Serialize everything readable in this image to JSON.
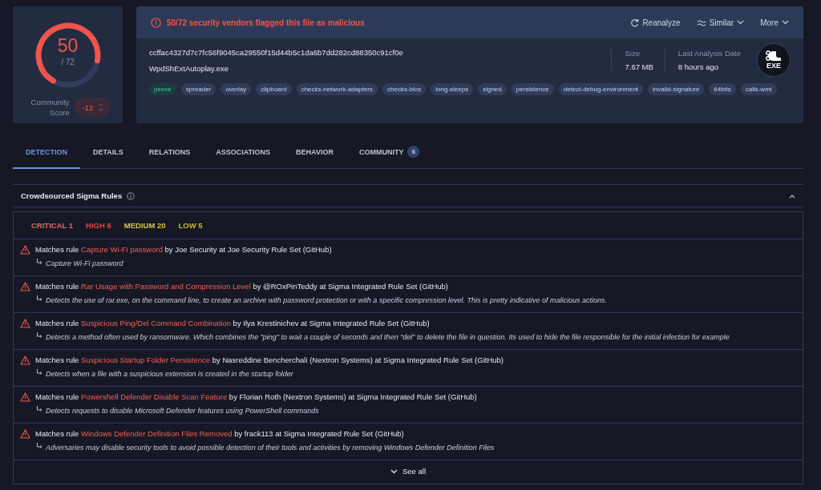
{
  "score": {
    "detections": "50",
    "total": "/ 72",
    "level": 0.694,
    "community_label": "Community Score",
    "community_value": "-12"
  },
  "alert": {
    "icon": "!",
    "text": "50/72 security vendors flagged this file as malicious"
  },
  "actions": [
    {
      "kind": "reanalyze",
      "label": "Reanalyze"
    },
    {
      "kind": "similar",
      "label": "Similar"
    },
    {
      "kind": "more",
      "label": "More"
    }
  ],
  "file": {
    "hash": "ccffac4327d7c7fc56f9045ca29550f15d44b5c1da6b7dd282cd88350c91cf0e",
    "name": "WpdShExtAutoplay.exe",
    "type_badge": "EXE"
  },
  "stats": [
    {
      "label": "Size",
      "value": "7.67 MB"
    },
    {
      "label": "Last Analysis Date",
      "value": "8 hours ago"
    }
  ],
  "tags": [
    {
      "label": "peexe",
      "kind": "filetype"
    },
    {
      "label": "spreader",
      "kind": "tag"
    },
    {
      "label": "overlay",
      "kind": "tag"
    },
    {
      "label": "clipboard",
      "kind": "tag"
    },
    {
      "label": "checks-network-adapters",
      "kind": "tag"
    },
    {
      "label": "checks-bios",
      "kind": "tag"
    },
    {
      "label": "long-sleeps",
      "kind": "tag"
    },
    {
      "label": "signed",
      "kind": "tag"
    },
    {
      "label": "persistence",
      "kind": "tag"
    },
    {
      "label": "detect-debug-environment",
      "kind": "tag"
    },
    {
      "label": "invalid-signature",
      "kind": "tag"
    },
    {
      "label": "64bits",
      "kind": "tag"
    },
    {
      "label": "calls-wmi",
      "kind": "tag"
    }
  ],
  "tabs": [
    {
      "label": "DETECTION",
      "selected": true
    },
    {
      "label": "DETAILS",
      "selected": false
    },
    {
      "label": "RELATIONS",
      "selected": false
    },
    {
      "label": "ASSOCIATIONS",
      "selected": false
    },
    {
      "label": "BEHAVIOR",
      "selected": false
    },
    {
      "label": "COMMUNITY",
      "selected": false,
      "badge": "6"
    }
  ],
  "section": {
    "title": "Crowdsourced Sigma Rules",
    "expanded": true
  },
  "severities": [
    {
      "label": "CRITICAL 1",
      "color": "#e06c6c"
    },
    {
      "label": "HIGH 6",
      "color": "#e04848"
    },
    {
      "label": "MEDIUM 20",
      "color": "#d8c440"
    },
    {
      "label": "LOW 5",
      "color": "#c8c020"
    }
  ],
  "rules": [
    {
      "prefix": "Matches rule",
      "name": "Capture Wi-Fi password",
      "suffix": "by Joe Security at Joe Security Rule Set (GitHub)",
      "description": "Capture Wi-Fi password"
    },
    {
      "prefix": "Matches rule",
      "name": "Rar Usage with Password and Compression Level",
      "suffix": "by @ROxPinTeddy at Sigma Integrated Rule Set (GitHub)",
      "description": "Detects the use of rar.exe, on the command line, to create an archive with password protection or with a specific compression level. This is pretty indicative of malicious actions."
    },
    {
      "prefix": "Matches rule",
      "name": "Suspicious Ping/Del Command Combination",
      "suffix": "by Ilya Krestinichev at Sigma Integrated Rule Set (GitHub)",
      "description": "Detects a method often used by ransomware. Which combines the \"ping\" to wait a couple of seconds and then \"del\" to delete the file in question. Its used to hide the file responsible for the initial infection for example"
    },
    {
      "prefix": "Matches rule",
      "name": "Suspicious Startup Folder Persistence",
      "suffix": "by Nasreddine Bencherchali (Nextron Systems) at Sigma Integrated Rule Set (GitHub)",
      "description": "Detects when a file with a suspicious extension is created in the startup folder"
    },
    {
      "prefix": "Matches rule",
      "name": "Powershell Defender Disable Scan Feature",
      "suffix": "by Florian Roth (Nextron Systems) at Sigma Integrated Rule Set (GitHub)",
      "description": "Detects requests to disable Microsoft Defender features using PowerShell commands"
    },
    {
      "prefix": "Matches rule",
      "name": "Windows Defender Definition Files Removed",
      "suffix": "by frack113 at Sigma Integrated Rule Set (GitHub)",
      "description": "Adversaries may disable security tools to avoid possible detection of their tools and activities by removing Windows Defender Definition Files"
    }
  ],
  "see_all": "See all"
}
